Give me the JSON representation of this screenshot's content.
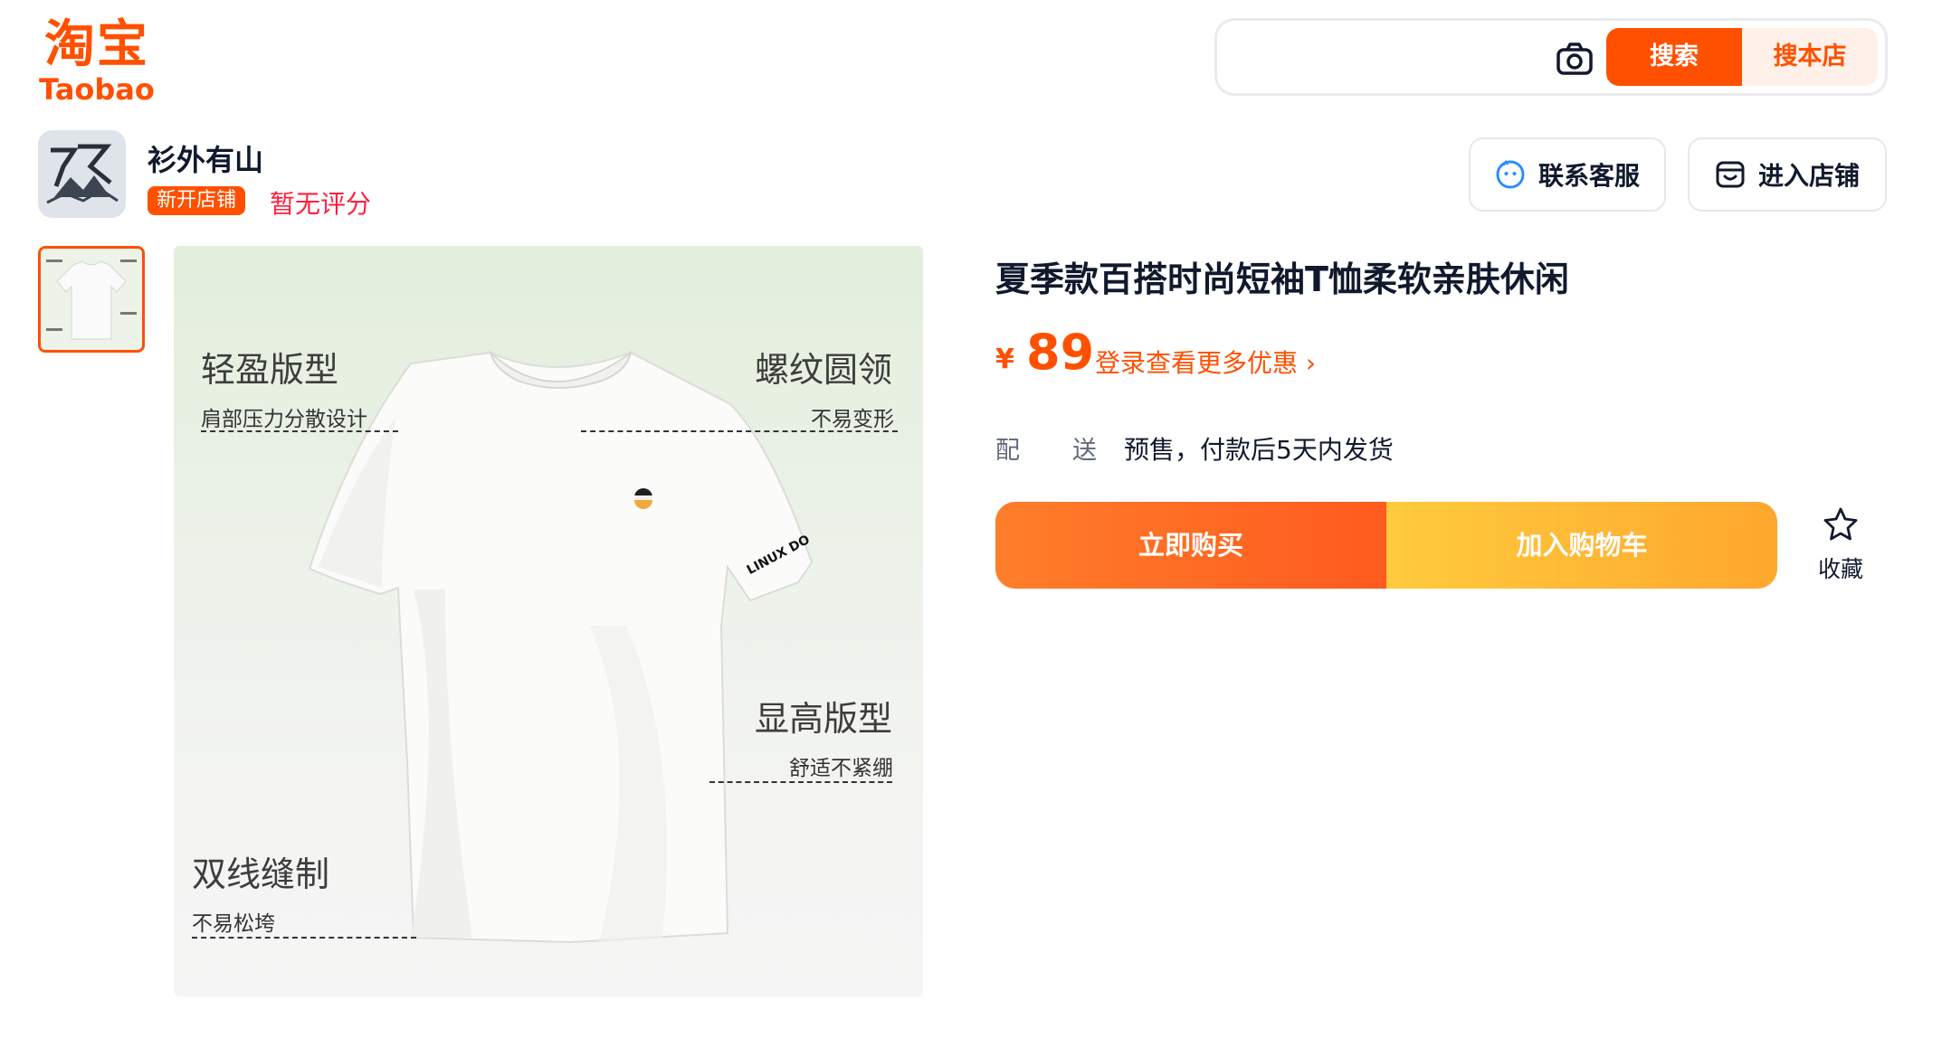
{
  "header": {
    "logo_cn": "淘宝",
    "logo_en": "Taobao",
    "search_placeholder": "",
    "search_button": "搜索",
    "shop_search_button": "搜本店",
    "camera_icon": "camera-icon"
  },
  "shop": {
    "name": "衫外有山",
    "badge": "新开店铺",
    "rating": "暂无评分",
    "contact_button": "联系客服",
    "enter_button": "进入店铺",
    "avatar_text": "衫外有山"
  },
  "gallery": {
    "features": [
      {
        "title": "轻盈版型",
        "subtitle": "肩部压力分散设计"
      },
      {
        "title": "螺纹圆领",
        "subtitle": "不易变形"
      },
      {
        "title": "显高版型",
        "subtitle": "舒适不紧绷"
      },
      {
        "title": "双线缝制",
        "subtitle": "不易松垮"
      }
    ],
    "sleeve_print": "LINUX DO"
  },
  "product": {
    "title": "夏季款百搭时尚短袖T恤柔软亲肤休闲",
    "currency": "¥",
    "price": "89",
    "promo": "登录查看更多优惠 ›",
    "shipping_label": "配送",
    "shipping_value": "预售，付款后5天内发货",
    "buy_button": "立即购买",
    "cart_button": "加入购物车",
    "favorite_label": "收藏"
  },
  "colors": {
    "brand": "#ff5000",
    "rating": "#ff1f3d",
    "text": "#11192d"
  }
}
